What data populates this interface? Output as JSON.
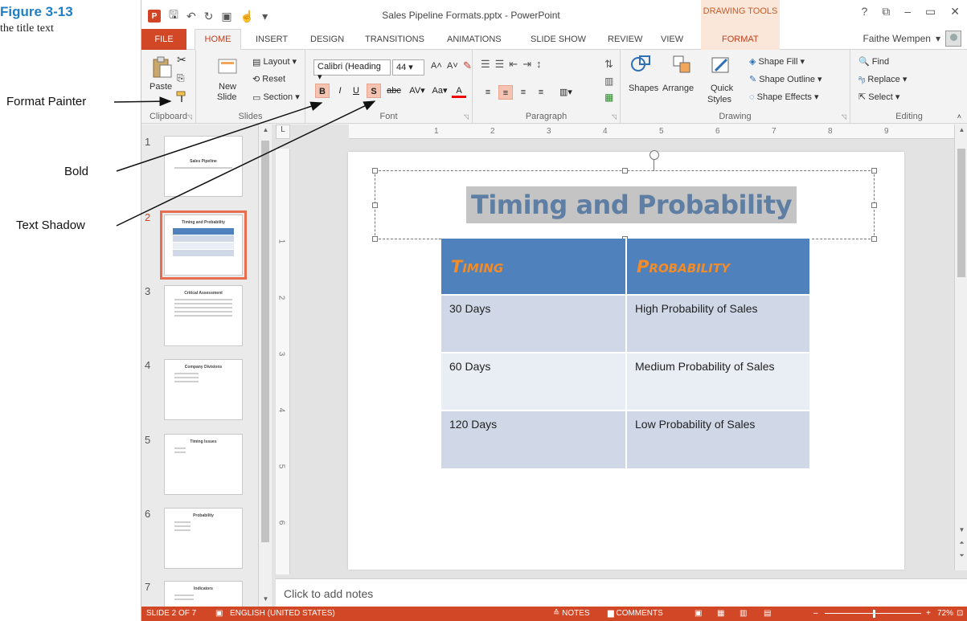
{
  "figure": {
    "number": "Figure 3-13",
    "caption": "the title text",
    "callouts": [
      "Format Painter",
      "Bold",
      "Text Shadow"
    ]
  },
  "window": {
    "title": "Sales Pipeline Formats.pptx - PowerPoint",
    "context_tab_group": "DRAWING TOOLS",
    "controls": [
      "?",
      "⧉",
      "–",
      "▭",
      "✕"
    ],
    "user": "Faithe Wempen"
  },
  "tabs": [
    "FILE",
    "HOME",
    "INSERT",
    "DESIGN",
    "TRANSITIONS",
    "ANIMATIONS",
    "SLIDE SHOW",
    "REVIEW",
    "VIEW",
    "FORMAT"
  ],
  "ribbon": {
    "clipboard": {
      "paste": "Paste",
      "label": "Clipboard"
    },
    "slides": {
      "new_slide_1": "New",
      "new_slide_2": "Slide",
      "layout": "Layout",
      "reset": "Reset",
      "section": "Section",
      "label": "Slides"
    },
    "font": {
      "font_name": "Calibri (Heading",
      "font_size": "44",
      "bold": "B",
      "italic": "I",
      "underline": "U",
      "shadow": "S",
      "strike": "abc",
      "spacing": "AV",
      "case": "Aa",
      "color": "A",
      "label": "Font"
    },
    "paragraph": {
      "label": "Paragraph"
    },
    "drawing": {
      "shapes": "Shapes",
      "arrange": "Arrange",
      "quick_1": "Quick",
      "quick_2": "Styles",
      "fill": "Shape Fill",
      "outline": "Shape Outline",
      "effects": "Shape Effects",
      "label": "Drawing"
    },
    "editing": {
      "find": "Find",
      "replace": "Replace",
      "select": "Select",
      "label": "Editing"
    },
    "accent": "#d24726"
  },
  "thumbnails": [
    {
      "num": "1",
      "title": "Sales Pipeline"
    },
    {
      "num": "2",
      "title": "Timing and Probability"
    },
    {
      "num": "3",
      "title": "Critical Assessment"
    },
    {
      "num": "4",
      "title": "Company Divisions"
    },
    {
      "num": "5",
      "title": "Timing Issues"
    },
    {
      "num": "6",
      "title": "Probability"
    },
    {
      "num": "7",
      "title": "Indicators"
    }
  ],
  "ruler": {
    "top": [
      "1",
      "2",
      "3",
      "4",
      "5",
      "6",
      "7",
      "8",
      "9"
    ],
    "left": [
      "1",
      "2",
      "3",
      "4",
      "5",
      "6"
    ]
  },
  "slide": {
    "title": "Timing and Probability",
    "table": {
      "headers": [
        "Timing",
        "Probability"
      ],
      "rows": [
        [
          "30 Days",
          "High Probability of Sales"
        ],
        [
          "60 Days",
          "Medium Probability of Sales"
        ],
        [
          "120 Days",
          "Low Probability of Sales"
        ]
      ]
    }
  },
  "notes_placeholder": "Click to add notes",
  "statusbar": {
    "slide": "SLIDE 2 OF 7",
    "language": "ENGLISH (UNITED STATES)",
    "notes": "NOTES",
    "comments": "COMMENTS",
    "zoom": "72%"
  }
}
